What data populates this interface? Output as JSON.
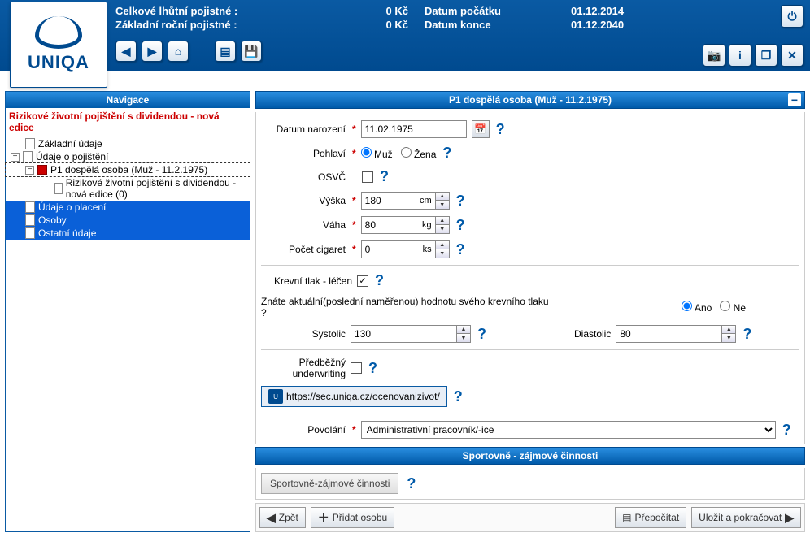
{
  "header": {
    "label_total_premium": "Celkové lhůtní pojistné :",
    "value_total_premium": "0 Kč",
    "label_annual_premium": "Základní roční pojistné :",
    "value_annual_premium": "0 Kč",
    "label_start_date": "Datum počátku",
    "label_end_date": "Datum konce",
    "value_start_date": "01.12.2014",
    "value_end_date": "01.12.2040"
  },
  "logo": {
    "text": "UNIQA"
  },
  "nav": {
    "title": "Navigace",
    "product": "Rizikové životní pojištění s dividendou - nová edice",
    "items": {
      "basic": "Základní údaje",
      "ins": "Údaje o pojištění",
      "p1": "P1 dospělá osoba (Muž - 11.2.1975)",
      "p1sub": "Rizikové životní pojištění s dividendou - nová edice (0)",
      "pay": "Údaje o placení",
      "persons": "Osoby",
      "other": "Ostatní údaje"
    }
  },
  "section": {
    "title": "P1 dospělá osoba (Muž - 11.2.1975)",
    "dob_label": "Datum narození",
    "dob_value": "11.02.1975",
    "sex_label": "Pohlaví",
    "sex_male": "Muž",
    "sex_female": "Žena",
    "osvc_label": "OSVČ",
    "height_label": "Výška",
    "height_value": "180",
    "height_unit": "cm",
    "weight_label": "Váha",
    "weight_value": "80",
    "weight_unit": "kg",
    "cig_label": "Počet cigaret",
    "cig_value": "0",
    "cig_unit": "ks",
    "bp_treated_label": "Krevní tlak - léčen",
    "bp_question": "Znáte aktuální(poslední naměřenou) hodnotu svého krevního tlaku ?",
    "yes": "Ano",
    "no": "Ne",
    "systolic_label": "Systolic",
    "systolic_value": "130",
    "diastolic_label": "Diastolic",
    "diastolic_value": "80",
    "pre_uw_label": "Předběžný underwriting",
    "url": "https://sec.uniqa.cz/ocenovanizivot/",
    "occupation_label": "Povolání",
    "occupation_value": "Administrativní pracovník/-ice",
    "sports_title": "Sportovně - zájmové činnosti",
    "sports_btn": "Sportovně-zájmové činnosti"
  },
  "bottom": {
    "back": "Zpět",
    "add_person": "Přidat osobu",
    "recalc": "Přepočítat",
    "save_continue": "Uložit a pokračovat"
  }
}
